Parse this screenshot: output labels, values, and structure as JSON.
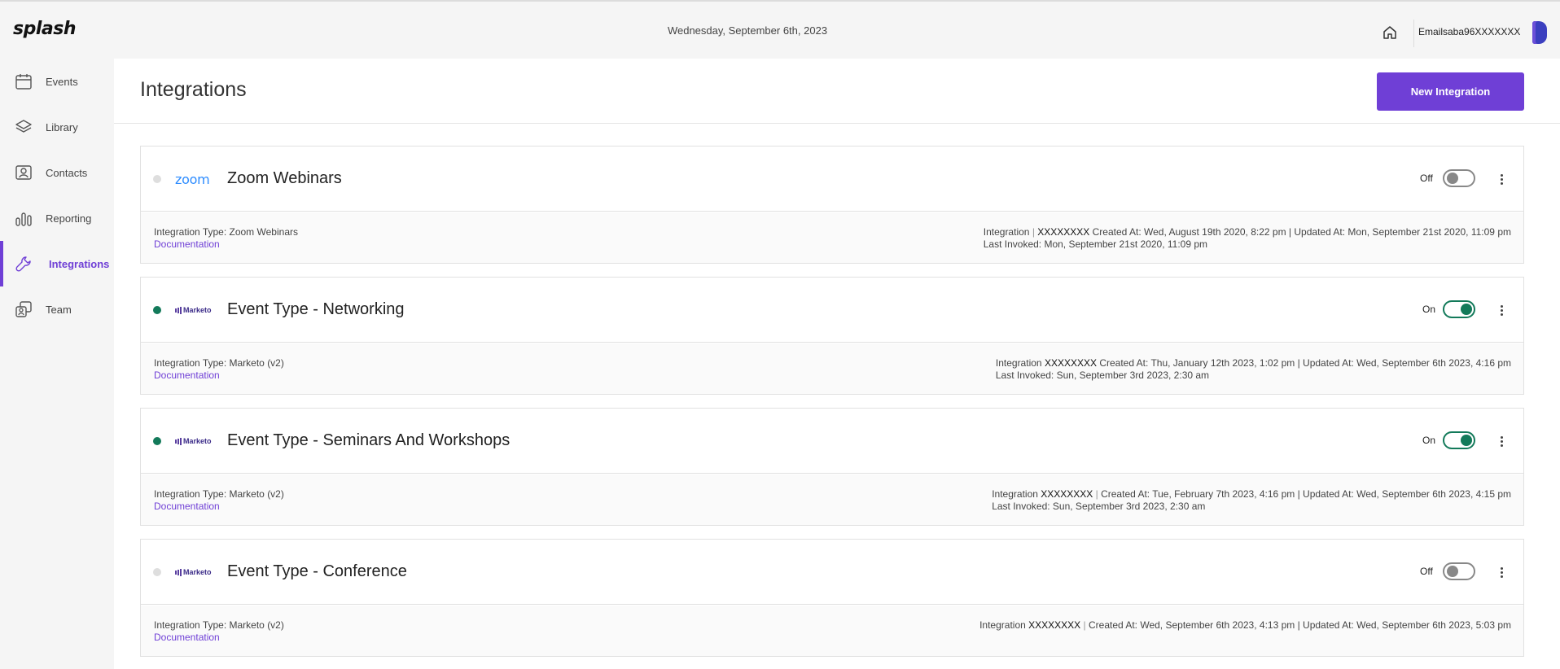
{
  "app": {
    "logo": "splash",
    "date": "Wednesday, September 6th, 2023",
    "user_email": "Emailsaba96XXXXXXX"
  },
  "sidebar": {
    "items": [
      {
        "label": "Events",
        "icon": "calendar-icon",
        "active": false
      },
      {
        "label": "Library",
        "icon": "layers-icon",
        "active": false
      },
      {
        "label": "Contacts",
        "icon": "contact-card-icon",
        "active": false
      },
      {
        "label": "Reporting",
        "icon": "bar-chart-icon",
        "active": false
      },
      {
        "label": "Integrations",
        "icon": "wrench-icon",
        "active": true
      },
      {
        "label": "Team",
        "icon": "team-icon",
        "active": false
      }
    ]
  },
  "page": {
    "title": "Integrations",
    "new_button": "New Integration"
  },
  "integrations": [
    {
      "name": "Zoom Webinars",
      "logo": "zoom",
      "status": "Off",
      "type_line": "Integration Type: Zoom Webinars",
      "doc_label": "Documentation",
      "integration_label": "Integration",
      "integration_id": "XXXXXXXX",
      "created": "Created At: Wed, August 19th 2020, 8:22 pm",
      "updated": "Updated At: Mon, September 21st 2020, 11:09 pm",
      "last_invoked": "Last Invoked: Mon, September 21st 2020, 11:09 pm"
    },
    {
      "name": "Event Type - Networking",
      "logo": "Marketo",
      "status": "On",
      "type_line": "Integration Type: Marketo (v2)",
      "doc_label": "Documentation",
      "integration_label": "Integration",
      "integration_id": "XXXXXXXX",
      "created": "Created At: Thu, January 12th 2023, 1:02 pm",
      "updated": "Updated At: Wed, September 6th 2023, 4:16 pm",
      "last_invoked": "Last Invoked: Sun, September 3rd 2023, 2:30 am"
    },
    {
      "name": "Event Type - Seminars And Workshops",
      "logo": "Marketo",
      "status": "On",
      "type_line": "Integration Type: Marketo (v2)",
      "doc_label": "Documentation",
      "integration_label": "Integration",
      "integration_id": "XXXXXXXX",
      "created": "Created At: Tue, February 7th 2023, 4:16 pm",
      "updated": "Updated At: Wed, September 6th 2023, 4:15 pm",
      "last_invoked": "Last Invoked: Sun, September 3rd 2023, 2:30 am"
    },
    {
      "name": "Event Type - Conference",
      "logo": "Marketo",
      "status": "Off",
      "type_line": "Integration Type: Marketo (v2)",
      "doc_label": "Documentation",
      "integration_label": "Integration",
      "integration_id": "XXXXXXXX",
      "created": "Created At: Wed, September 6th 2023, 4:13 pm",
      "updated": "Updated At: Wed, September 6th 2023, 5:03 pm",
      "last_invoked": ""
    }
  ],
  "colors": {
    "accent": "#6f3fd6",
    "status_on": "#137a5a",
    "status_off": "#dedede",
    "zoom_blue": "#2d8cff"
  }
}
